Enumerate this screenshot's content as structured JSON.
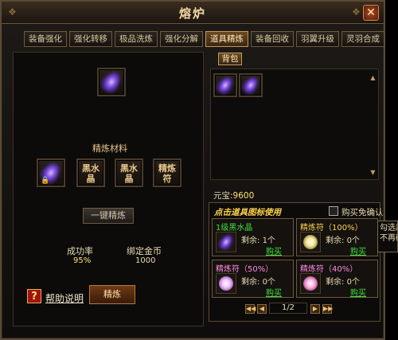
{
  "window": {
    "title": "熔炉",
    "close_label": "✕"
  },
  "tabs": [
    {
      "label": "装备强化"
    },
    {
      "label": "强化转移"
    },
    {
      "label": "极品洗炼"
    },
    {
      "label": "强化分解"
    },
    {
      "label": "道具精炼",
      "active": true
    },
    {
      "label": "装备回收"
    },
    {
      "label": "羽翼升级"
    },
    {
      "label": "灵羽合成"
    }
  ],
  "refine": {
    "materials_label": "精炼材料",
    "materials": [
      {
        "text": ""
      },
      {
        "text": "黑水晶"
      },
      {
        "text": "黑水晶"
      },
      {
        "text": "精炼符"
      }
    ],
    "one_click_label": "一键精炼",
    "success_rate_label": "成功率",
    "success_rate_value": "95%",
    "bound_gold_label": "绑定金币",
    "bound_gold_value": "1000",
    "help_label": "帮助说明",
    "refine_button": "精炼"
  },
  "bag": {
    "tab_label": "背包",
    "yuanbao_label": "元宝:",
    "yuanbao_value": "9600"
  },
  "shop": {
    "header": "点击道具图标使用",
    "no_confirm_label": "购买免确认",
    "items": [
      {
        "name": "1级黑水晶",
        "name_color": "#40e040",
        "remain_label": "剩余:",
        "remain": "1个",
        "buy": "购买",
        "glow": "#7e4fd8"
      },
      {
        "name": "精炼符（100%）",
        "name_color": "#ffd34a",
        "remain_label": "剩余:",
        "remain": "0个",
        "buy": "购买",
        "glow": "#f5e9a0"
      },
      {
        "name": "精炼符（50%）",
        "name_color": "#ff8ae0",
        "remain_label": "剩余:",
        "remain": "0个",
        "buy": "购买",
        "glow": "#f0c0ff"
      },
      {
        "name": "精炼符（40%）",
        "name_color": "#ff8ae0",
        "remain_label": "剩余:",
        "remain": "0个",
        "buy": "购买",
        "glow": "#ffb0e0"
      }
    ],
    "page": "1/2"
  },
  "tooltip": {
    "line1": "勾选后",
    "line2": "不再确认"
  }
}
